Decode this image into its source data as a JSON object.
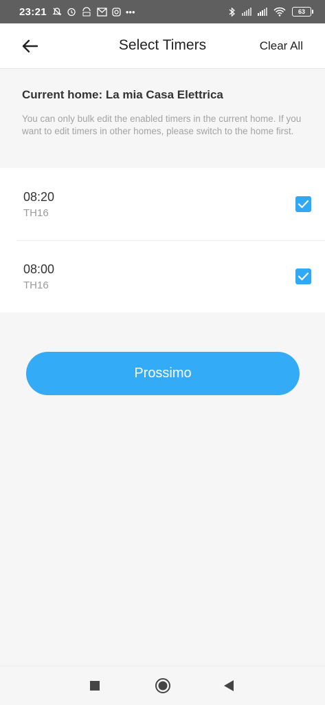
{
  "status_bar": {
    "time": "23:21",
    "battery": "63",
    "notification_icons": [
      "mute-icon",
      "alarm-icon",
      "data-saver-icon",
      "mail-icon",
      "instagram-icon",
      "more-dots-icon"
    ],
    "more": "•••"
  },
  "header": {
    "title": "Select Timers",
    "clear_all": "Clear All"
  },
  "info": {
    "title": "Current home: La mia Casa Elettrica",
    "description": "You can only bulk edit the enabled timers in the current home. If you want to edit timers in other homes, please switch to the home first."
  },
  "timers": [
    {
      "time": "08:20",
      "device": "TH16",
      "checked": true
    },
    {
      "time": "08:00",
      "device": "TH16",
      "checked": true
    }
  ],
  "next_button": {
    "label": "Prossimo"
  },
  "colors": {
    "accent": "#34abf6",
    "checkbox": "#2fa8f5",
    "status_bar": "#5f5f5f",
    "background": "#f6f6f6"
  }
}
